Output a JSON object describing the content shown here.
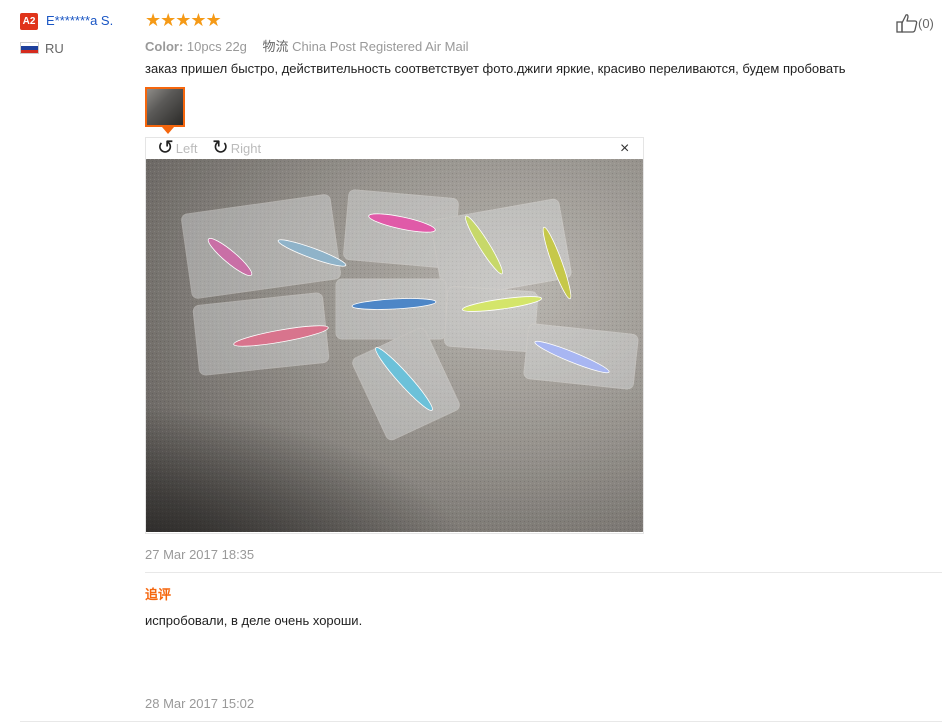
{
  "review": {
    "level_badge": "A2",
    "user_name": "E*******a S.",
    "country_code": "RU",
    "stars": "★★★★★",
    "color_label": "Color:",
    "color_value": "10pcs 22g",
    "shipping_label": "物流",
    "shipping_value": "China Post Registered Air Mail",
    "text": "заказ пришел быстро, действительность соответствует фото.джиги яркие, красиво переливаются, будем пробовать",
    "rotate_left": "Left",
    "rotate_right": "Right",
    "close": "×",
    "date": "27 Mar 2017 18:35",
    "helpful_count": "(0)"
  },
  "followup": {
    "label": "追评",
    "text": "испробовали, в деле очень хороши.",
    "date": "28 Mar 2017 15:02"
  },
  "colors": {
    "accent": "#f5660d",
    "link": "#1a56c4",
    "badge": "#e0341a",
    "star": "#f59a17"
  }
}
